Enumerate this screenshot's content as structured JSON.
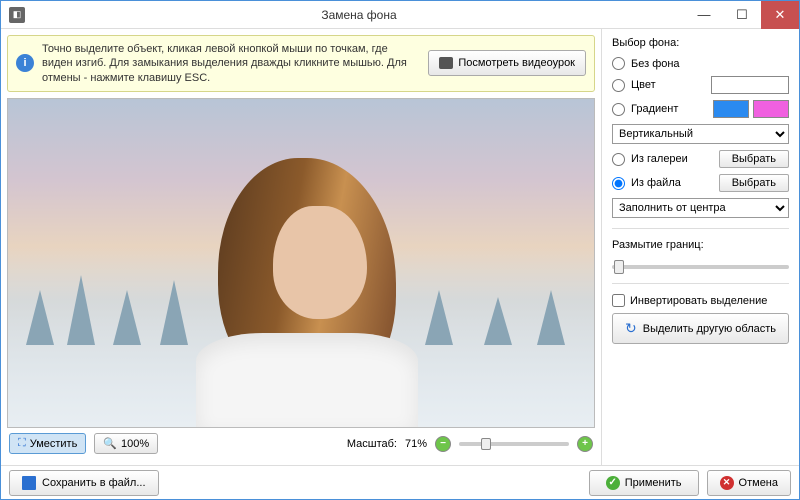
{
  "window": {
    "title": "Замена фона"
  },
  "hint": {
    "text": "Точно выделите объект, кликая левой кнопкой мыши по точкам, где виден изгиб. Для замыкания выделения дважды кликните мышью. Для отмены - нажмите клавишу ESC.",
    "video_button": "Посмотреть видеоурок"
  },
  "toolbar": {
    "fit": "Уместить",
    "zoom_value": "100%",
    "scale_label": "Масштаб:",
    "scale_value": "71%"
  },
  "sidebar": {
    "title": "Выбор фона:",
    "no_bg": "Без фона",
    "color": "Цвет",
    "gradient": "Градиент",
    "gradient_type": "Вертикальный",
    "from_gallery": "Из галереи",
    "from_file": "Из файла",
    "choose": "Выбрать",
    "fill_mode": "Заполнить от центра",
    "blur_label": "Размытие границ:",
    "invert": "Инвертировать выделение",
    "select_other": "Выделить другую область",
    "colors": {
      "swatch": "#ffffff",
      "grad1": "#2a8af0",
      "grad2": "#f060e0"
    }
  },
  "bottom": {
    "save": "Сохранить в файл...",
    "apply": "Применить",
    "cancel": "Отмена"
  }
}
